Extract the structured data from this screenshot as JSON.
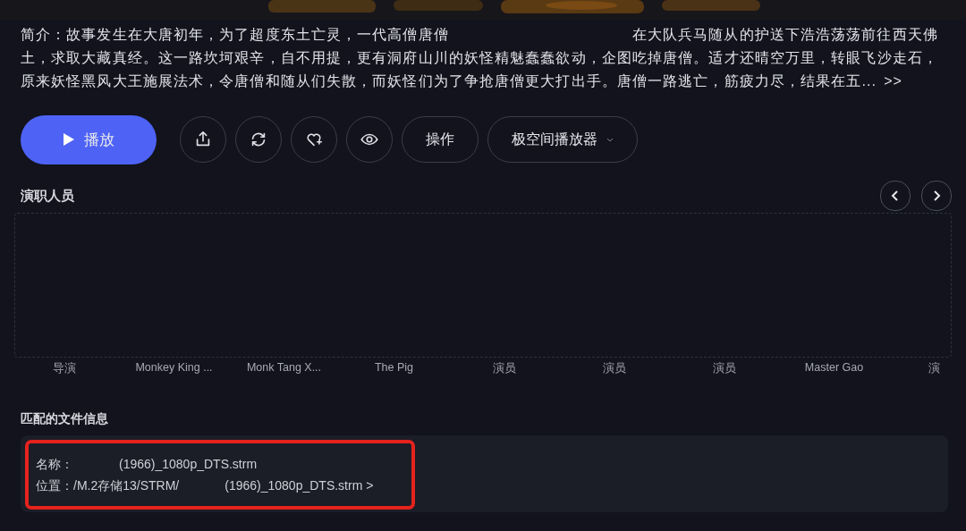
{
  "summary": {
    "before": "简介：故事发生在大唐初年，为了超度东土亡灵，一代高僧唐僧",
    "after": "在大队兵马随从的护送下浩浩荡荡前往西天佛土，求取大藏真经。这一路坎坷艰辛，自不用提，更有洞府山川的妖怪精魅蠢蠢欲动，企图吃掉唐僧。适才还晴空万里，转眼飞沙走石，原来妖怪黑风大王施展法术，令唐僧和随从们失散，而妖怪们为了争抢唐僧更大打出手。唐僧一路逃亡，筋疲力尽，结果在五...",
    "more": ">>"
  },
  "actions": [
    {
      "kind": "primary",
      "label": "播放"
    },
    {
      "kind": "share"
    },
    {
      "kind": "refresh"
    },
    {
      "kind": "favorite"
    },
    {
      "kind": "watched"
    },
    {
      "kind": "text",
      "label": "操作"
    },
    {
      "kind": "dropdown",
      "label": "极空间播放器"
    }
  ],
  "cast": {
    "title": "演职人员",
    "members": [
      "导演",
      "Monkey King ...",
      "Monk Tang X...",
      "The Pig",
      "演员",
      "演员",
      "演员",
      "Master Gao",
      "演"
    ]
  },
  "file_info": {
    "title": "匹配的文件信息",
    "name_label": "名称：",
    "name": "(1966)_1080p_DTS.strm",
    "location_label": "位置：",
    "location_prefix": "/M.2存储13/STRM/",
    "location_file": "(1966)_1080p_DTS.strm >"
  }
}
